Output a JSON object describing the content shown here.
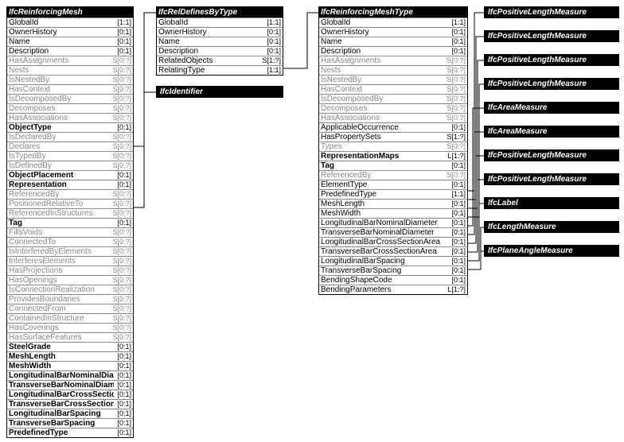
{
  "left": {
    "title": "IfcReinforcingMesh",
    "rows": [
      {
        "c": "GlobalId",
        "k": "[1:1]",
        "b": false,
        "g": false
      },
      {
        "c": "OwnerHistory",
        "k": "[0:1]",
        "b": false,
        "g": false
      },
      {
        "c": "Name",
        "k": "[0:1]",
        "b": false,
        "g": false
      },
      {
        "c": "Description",
        "k": "[0:1]",
        "b": false,
        "g": false
      },
      {
        "c": "HasAssignments",
        "k": "S[0:?]",
        "b": false,
        "g": true
      },
      {
        "c": "Nests",
        "k": "S[0:?]",
        "b": false,
        "g": true
      },
      {
        "c": "IsNestedBy",
        "k": "S[0:?]",
        "b": false,
        "g": true
      },
      {
        "c": "HasContext",
        "k": "S[0:?]",
        "b": false,
        "g": true
      },
      {
        "c": "IsDecomposedBy",
        "k": "S[0:?]",
        "b": false,
        "g": true
      },
      {
        "c": "Decomposes",
        "k": "S[0:?]",
        "b": false,
        "g": true
      },
      {
        "c": "HasAssociations",
        "k": "S[0:?]",
        "b": false,
        "g": true
      },
      {
        "c": "ObjectType",
        "k": "[0:1]",
        "b": true,
        "g": false
      },
      {
        "c": "IsDeclaredBy",
        "k": "S[0:?]",
        "b": false,
        "g": true
      },
      {
        "c": "Declares",
        "k": "S[0:?]",
        "b": false,
        "g": true
      },
      {
        "c": "IsTypedBy",
        "k": "S[0:?]",
        "b": false,
        "g": true
      },
      {
        "c": "IsDefinedBy",
        "k": "S[0:?]",
        "b": false,
        "g": true
      },
      {
        "c": "ObjectPlacement",
        "k": "[0:1]",
        "b": true,
        "g": false
      },
      {
        "c": "Representation",
        "k": "[0:1]",
        "b": true,
        "g": false
      },
      {
        "c": "ReferencedBy",
        "k": "S[0:?]",
        "b": false,
        "g": true
      },
      {
        "c": "PositionedRelativeTo",
        "k": "S[0:?]",
        "b": false,
        "g": true
      },
      {
        "c": "ReferencedInStructures",
        "k": "S[0:?]",
        "b": false,
        "g": true
      },
      {
        "c": "Tag",
        "k": "[0:1]",
        "b": true,
        "g": false
      },
      {
        "c": "FillsVoids",
        "k": "S[0:?]",
        "b": false,
        "g": true
      },
      {
        "c": "ConnectedTo",
        "k": "S[0:?]",
        "b": false,
        "g": true
      },
      {
        "c": "IsInterferedByElements",
        "k": "S[0:?]",
        "b": false,
        "g": true
      },
      {
        "c": "InterferesElements",
        "k": "S[0:?]",
        "b": false,
        "g": true
      },
      {
        "c": "HasProjections",
        "k": "S[0:?]",
        "b": false,
        "g": true
      },
      {
        "c": "HasOpenings",
        "k": "S[0:?]",
        "b": false,
        "g": true
      },
      {
        "c": "IsConnectionRealization",
        "k": "S[0:?]",
        "b": false,
        "g": true
      },
      {
        "c": "ProvidesBoundaries",
        "k": "S[0:?]",
        "b": false,
        "g": true
      },
      {
        "c": "ConnectedFrom",
        "k": "S[0:?]",
        "b": false,
        "g": true
      },
      {
        "c": "ContainedInStructure",
        "k": "S[0:?]",
        "b": false,
        "g": true
      },
      {
        "c": "HasCoverings",
        "k": "S[0:?]",
        "b": false,
        "g": true
      },
      {
        "c": "HasSurfaceFeatures",
        "k": "S[0:?]",
        "b": false,
        "g": true
      },
      {
        "c": "SteelGrade",
        "k": "[0:1]",
        "b": true,
        "g": false
      },
      {
        "c": "MeshLength",
        "k": "[0:1]",
        "b": true,
        "g": false
      },
      {
        "c": "MeshWidth",
        "k": "[0:1]",
        "b": true,
        "g": false
      },
      {
        "c": "LongitudinalBarNominalDiameter",
        "k": "[0:1]",
        "b": true,
        "g": false
      },
      {
        "c": "TransverseBarNominalDiameter",
        "k": "[0:1]",
        "b": true,
        "g": false
      },
      {
        "c": "LongitudinalBarCrossSectionArea",
        "k": "[0:1]",
        "b": true,
        "g": false
      },
      {
        "c": "TransverseBarCrossSectionArea",
        "k": "[0:1]",
        "b": true,
        "g": false
      },
      {
        "c": "LongitudinalBarSpacing",
        "k": "[0:1]",
        "b": true,
        "g": false
      },
      {
        "c": "TransverseBarSpacing",
        "k": "[0:1]",
        "b": true,
        "g": false
      },
      {
        "c": "PredefinedType",
        "k": "[0:1]",
        "b": true,
        "g": false
      }
    ]
  },
  "mid": {
    "title": "IfcRelDefinesByType",
    "rows": [
      {
        "c": "GlobalId",
        "k": "[1:1]",
        "b": false,
        "g": false
      },
      {
        "c": "OwnerHistory",
        "k": "[0:1]",
        "b": false,
        "g": false
      },
      {
        "c": "Name",
        "k": "[0:1]",
        "b": false,
        "g": false
      },
      {
        "c": "Description",
        "k": "[0:1]",
        "b": false,
        "g": false
      },
      {
        "c": "RelatedObjects",
        "k": "S[1:?]",
        "b": false,
        "g": false
      },
      {
        "c": "RelatingType",
        "k": "[1:1]",
        "b": false,
        "g": false
      }
    ]
  },
  "identifier": "IfcIdentifier",
  "right": {
    "title": "IfcReinforcingMeshType",
    "rows": [
      {
        "c": "GlobalId",
        "k": "[1:1]",
        "b": false,
        "g": false
      },
      {
        "c": "OwnerHistory",
        "k": "[0:1]",
        "b": false,
        "g": false
      },
      {
        "c": "Name",
        "k": "[0:1]",
        "b": false,
        "g": false
      },
      {
        "c": "Description",
        "k": "[0:1]",
        "b": false,
        "g": false
      },
      {
        "c": "HasAssignments",
        "k": "S[0:?]",
        "b": false,
        "g": true
      },
      {
        "c": "Nests",
        "k": "S[0:?]",
        "b": false,
        "g": true
      },
      {
        "c": "IsNestedBy",
        "k": "S[0:?]",
        "b": false,
        "g": true
      },
      {
        "c": "HasContext",
        "k": "S[0:?]",
        "b": false,
        "g": true
      },
      {
        "c": "IsDecomposedBy",
        "k": "S[0:?]",
        "b": false,
        "g": true
      },
      {
        "c": "Decomposes",
        "k": "S[0:?]",
        "b": false,
        "g": true
      },
      {
        "c": "HasAssociations",
        "k": "S[0:?]",
        "b": false,
        "g": true
      },
      {
        "c": "ApplicableOccurrence",
        "k": "[0:1]",
        "b": false,
        "g": false
      },
      {
        "c": "HasPropertySets",
        "k": "S[1:?]",
        "b": false,
        "g": false
      },
      {
        "c": "Types",
        "k": "S[0:?]",
        "b": false,
        "g": true
      },
      {
        "c": "RepresentationMaps",
        "k": "L[1:?]",
        "b": true,
        "g": false
      },
      {
        "c": "Tag",
        "k": "[0:1]",
        "b": true,
        "g": false
      },
      {
        "c": "ReferencedBy",
        "k": "S[0:?]",
        "b": false,
        "g": true
      },
      {
        "c": "ElementType",
        "k": "[0:1]",
        "b": false,
        "g": false
      },
      {
        "c": "PredefinedType",
        "k": "[1:1]",
        "b": false,
        "g": false
      },
      {
        "c": "MeshLength",
        "k": "[0:1]",
        "b": false,
        "g": false
      },
      {
        "c": "MeshWidth",
        "k": "[0:1]",
        "b": false,
        "g": false
      },
      {
        "c": "LongitudinalBarNominalDiameter",
        "k": "[0:1]",
        "b": false,
        "g": false
      },
      {
        "c": "TransverseBarNominalDiameter",
        "k": "[0:1]",
        "b": false,
        "g": false
      },
      {
        "c": "LongitudinalBarCrossSectionArea",
        "k": "[0:1]",
        "b": false,
        "g": false
      },
      {
        "c": "TransverseBarCrossSectionArea",
        "k": "[0:1]",
        "b": false,
        "g": false
      },
      {
        "c": "LongitudinalBarSpacing",
        "k": "[0:1]",
        "b": false,
        "g": false
      },
      {
        "c": "TransverseBarSpacing",
        "k": "[0:1]",
        "b": false,
        "g": false
      },
      {
        "c": "BendingShapeCode",
        "k": "[0:1]",
        "b": false,
        "g": false
      },
      {
        "c": "BendingParameters",
        "k": "L[1:?]",
        "b": false,
        "g": false
      }
    ]
  },
  "types": [
    "IfcPositiveLengthMeasure",
    "IfcPositiveLengthMeasure",
    "IfcPositiveLengthMeasure",
    "IfcPositiveLengthMeasure",
    "IfcAreaMeasure",
    "IfcAreaMeasure",
    "IfcPositiveLengthMeasure",
    "IfcPositiveLengthMeasure",
    "IfcLabel",
    "IfcLengthMeasure",
    "IfcPlaneAngleMeasure"
  ]
}
